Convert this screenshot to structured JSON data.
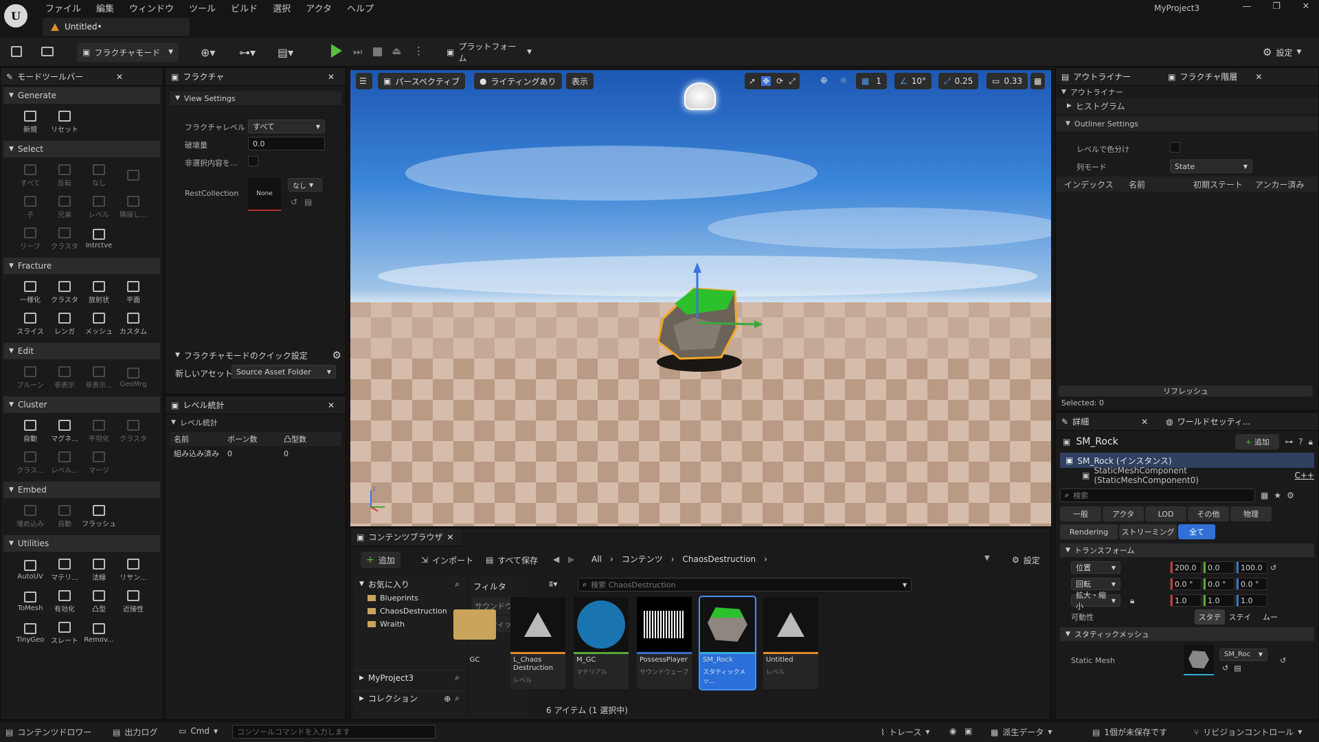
{
  "app": {
    "project": "MyProject3",
    "doc_tab": "Untitled•"
  },
  "menu": [
    "ファイル",
    "編集",
    "ウィンドウ",
    "ツール",
    "ビルド",
    "選択",
    "アクタ",
    "ヘルプ"
  ],
  "toolbar": {
    "mode": "フラクチャモード",
    "platform": "プラットフォーム",
    "settings": "設定"
  },
  "modes": {
    "tab": "モードツールバー",
    "sections": [
      {
        "title": "Generate",
        "tools": [
          {
            "label": "新規",
            "dim": false
          },
          {
            "label": "リセット",
            "dim": false
          }
        ]
      },
      {
        "title": "Select",
        "tools": [
          {
            "label": "すべて",
            "dim": true
          },
          {
            "label": "反転",
            "dim": true
          },
          {
            "label": "なし",
            "dim": true
          },
          {
            "label": "",
            "dim": true
          },
          {
            "label": "子",
            "dim": true
          },
          {
            "label": "兄弟",
            "dim": true
          },
          {
            "label": "レベル",
            "dim": true
          },
          {
            "label": "隣接し...",
            "dim": true
          },
          {
            "label": "リーフ",
            "dim": true
          },
          {
            "label": "クラスタ",
            "dim": true
          },
          {
            "label": "Intrctve",
            "dim": false
          }
        ]
      },
      {
        "title": "Fracture",
        "tools": [
          {
            "label": "一様化",
            "dim": false
          },
          {
            "label": "クラスタ",
            "dim": false
          },
          {
            "label": "放射状",
            "dim": false
          },
          {
            "label": "平面",
            "dim": false
          },
          {
            "label": "スライス",
            "dim": false
          },
          {
            "label": "レンガ",
            "dim": false
          },
          {
            "label": "メッシュ",
            "dim": false
          },
          {
            "label": "カスタム",
            "dim": false
          }
        ]
      },
      {
        "title": "Edit",
        "tools": [
          {
            "label": "プルーン",
            "dim": true
          },
          {
            "label": "非表示",
            "dim": true
          },
          {
            "label": "非表示...",
            "dim": true
          },
          {
            "label": "GeoMrg",
            "dim": true
          }
        ]
      },
      {
        "title": "Cluster",
        "tools": [
          {
            "label": "自動",
            "dim": false
          },
          {
            "label": "マグネ...",
            "dim": false
          },
          {
            "label": "平坦化",
            "dim": true
          },
          {
            "label": "クラスタ",
            "dim": true
          },
          {
            "label": "クラス...",
            "dim": true
          },
          {
            "label": "レベル...",
            "dim": true
          },
          {
            "label": "マージ",
            "dim": true
          }
        ]
      },
      {
        "title": "Embed",
        "tools": [
          {
            "label": "埋め込み",
            "dim": true
          },
          {
            "label": "自動",
            "dim": true
          },
          {
            "label": "フラッシュ",
            "dim": false
          }
        ]
      },
      {
        "title": "Utilities",
        "tools": [
          {
            "label": "AutoUV",
            "dim": false
          },
          {
            "label": "マテリ...",
            "dim": false
          },
          {
            "label": "法線",
            "dim": false
          },
          {
            "label": "リサン...",
            "dim": false
          },
          {
            "label": "ToMesh",
            "dim": false
          },
          {
            "label": "有効化",
            "dim": false
          },
          {
            "label": "凸型",
            "dim": false
          },
          {
            "label": "近接性",
            "dim": false
          },
          {
            "label": "TinyGeo",
            "dim": false
          },
          {
            "label": "スレート",
            "dim": false
          },
          {
            "label": "Remov...",
            "dim": false
          }
        ]
      }
    ]
  },
  "fracture": {
    "tab": "フラクチャ",
    "view_settings": "View Settings",
    "level_label": "フラクチャレベル",
    "level_value": "すべて",
    "destroy_label": "破壊量",
    "destroy_value": "0.0",
    "hide_label": "非選択内容を...",
    "rest_label": "RestCollection",
    "rest_value": "None",
    "rest_dd": "なし",
    "quick": "フラクチャモードのクイック設定",
    "new_asset_label": "新しいアセット",
    "new_asset_value": "Source Asset Folder"
  },
  "level_stats": {
    "tab": "レベル統計",
    "header": "レベル統計",
    "cols": [
      "名前",
      "ボーン数",
      "凸型数"
    ],
    "row": [
      "組み込み済み",
      "0",
      "0"
    ]
  },
  "viewport": {
    "perspective": "パースペクティブ",
    "lit": "ライティングあり",
    "show": "表示",
    "grid": "1",
    "angle": "10°",
    "scale": "0.25",
    "cam": "0.33"
  },
  "outliner": {
    "tab": "アウトライナー",
    "tab2": "フラクチャ階層",
    "title": "アウトライナー",
    "histogram": "ヒストグラム",
    "settings": "Outliner Settings",
    "color_label": "レベルで色分け",
    "col_mode_label": "列モード",
    "col_mode_value": "State",
    "cols": [
      "インデックス",
      "名前",
      "初期ステート",
      "アンカー済み"
    ],
    "refresh": "リフレッシュ",
    "selected": "Selected: 0"
  },
  "details": {
    "tab": "詳細",
    "tab2": "ワールドセッティ...",
    "actor": "SM_Rock",
    "add": "追加",
    "inst": "SM_Rock (インスタンス)",
    "comp": "StaticMeshComponent (StaticMeshComponent0)",
    "comp_link": "C++",
    "search": "検索",
    "filters": [
      "一般",
      "アクタ",
      "LOD",
      "その他",
      "物理"
    ],
    "filters2": [
      "Rendering",
      "ストリーミング",
      "全て"
    ],
    "transform": "トランスフォーム",
    "loc": "位置",
    "rot": "回転",
    "scl": "拡大・縮小",
    "loc_v": [
      "200.0",
      "0.0",
      "100.0"
    ],
    "rot_v": [
      "0.0 °",
      "0.0 °",
      "0.0 °"
    ],
    "scl_v": [
      "1.0",
      "1.0",
      "1.0"
    ],
    "mob": "可動性",
    "mob_v": [
      "スタテ",
      "ステイ",
      "ムー"
    ],
    "sm_sec": "スタティックメッシュ",
    "sm_label": "Static Mesh",
    "sm_value": "SM_Roc"
  },
  "content": {
    "tab": "コンテンツブラウザ",
    "add": "追加",
    "import": "インポート",
    "saveall": "すべて保存",
    "settings": "設定",
    "path": [
      "All",
      "コンテンツ",
      "ChaosDestruction"
    ],
    "fav": "お気に入り",
    "folders": [
      "Blueprints",
      "ChaosDestruction",
      "Wraith"
    ],
    "project": "MyProject3",
    "collection": "コレクション",
    "filter": "フィルタ",
    "filter_items": [
      "サウンドウェ...",
      "スタティック..."
    ],
    "search": "検索 ChaosDestruction",
    "count": "6 アイテム (1 選択中)",
    "assets": [
      {
        "name": "GC",
        "type": "",
        "color": "#caa15a"
      },
      {
        "name": "L_Chaos Destruction",
        "type": "レベル",
        "color": "#e08a2c"
      },
      {
        "name": "M_GC",
        "type": "マテリアル",
        "color": "#5aa83a"
      },
      {
        "name": "PossessPlayer",
        "type": "サウンドウェーブ",
        "color": "#3a6fd0"
      },
      {
        "name": "SM_Rock",
        "type": "スタティックメッ...",
        "color": "#2fb0d9"
      },
      {
        "name": "Untitled",
        "type": "レベル",
        "color": "#e08a2c"
      }
    ]
  },
  "status": {
    "drawer": "コンテンツドロワー",
    "log": "出力ログ",
    "cmd": "Cmd",
    "console_ph": "コンソールコマンドを入力します",
    "trace": "トレース",
    "derived": "派生データ",
    "unsaved": "1個が未保存です",
    "revision": "リビジョンコントロール"
  }
}
